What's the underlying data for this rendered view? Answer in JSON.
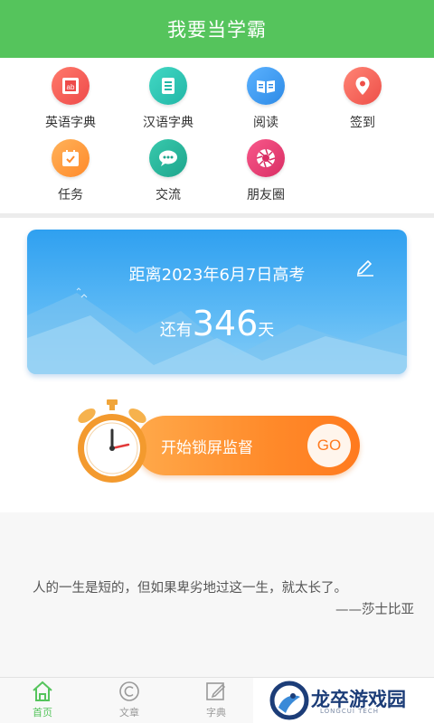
{
  "header": {
    "title": "我要当学霸",
    "bg_color": "#55c45c"
  },
  "features": [
    {
      "label": "英语字典",
      "icon": "dictionary-ab-icon",
      "color": "#f25a55"
    },
    {
      "label": "汉语字典",
      "icon": "book-icon",
      "color": "#2fc7b4"
    },
    {
      "label": "阅读",
      "icon": "open-book-icon",
      "color": "#3b9af0"
    },
    {
      "label": "签到",
      "icon": "location-pin-icon",
      "color": "#f66a5c"
    },
    {
      "label": "任务",
      "icon": "calendar-check-icon",
      "color": "#ff9a3c"
    },
    {
      "label": "交流",
      "icon": "chat-bubble-icon",
      "color": "#2cb89e"
    },
    {
      "label": "朋友圈",
      "icon": "aperture-icon",
      "color": "#ee3f74"
    }
  ],
  "countdown": {
    "title": "距离2023年6月7日高考",
    "prefix": "还有",
    "days": "346",
    "suffix": "天",
    "edit_icon": "edit-pen-icon"
  },
  "lock": {
    "label": "开始锁屏监督",
    "go": "GO",
    "icon": "alarm-clock-icon"
  },
  "quote": {
    "text": "人的一生是短的，但如果卑劣地过这一生，就太长了。",
    "author": "——莎士比亚"
  },
  "tabs": [
    {
      "label": "首页",
      "icon": "home-icon",
      "active": true
    },
    {
      "label": "文章",
      "icon": "copyright-circle-icon",
      "active": false
    },
    {
      "label": "字典",
      "icon": "edit-box-icon",
      "active": false
    }
  ],
  "watermark": {
    "text": "龙卒游戏园",
    "sub": "LONGCUI TECH"
  }
}
